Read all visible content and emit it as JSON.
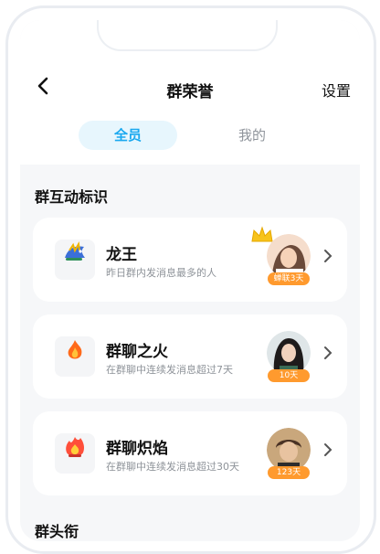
{
  "header": {
    "back_icon": "chevron-left-icon",
    "title": "群荣誉",
    "settings_label": "设置"
  },
  "tabs": [
    {
      "label": "全员",
      "active": true
    },
    {
      "label": "我的",
      "active": false
    }
  ],
  "sections": {
    "interaction_title": "群互动标识",
    "heads_title": "群头衔"
  },
  "cards": [
    {
      "icon": "dragon-king-icon",
      "name": "龙王",
      "desc": "昨日群内发消息最多的人",
      "badge": "蝉联3天",
      "has_crown": true,
      "avatar_color": "#f2c8a8"
    },
    {
      "icon": "fire-icon",
      "name": "群聊之火",
      "desc": "在群聊中连续发消息超过7天",
      "badge": "10天",
      "has_crown": false,
      "avatar_color": "#3c3a3a"
    },
    {
      "icon": "flame-icon",
      "name": "群聊炽焰",
      "desc": "在群聊中连续发消息超过30天",
      "badge": "123天",
      "has_crown": false,
      "avatar_color": "#b58a5a"
    }
  ],
  "colors": {
    "accent": "#19a8ef",
    "badge": "#ff9a2e",
    "background": "#f6f7f9"
  }
}
